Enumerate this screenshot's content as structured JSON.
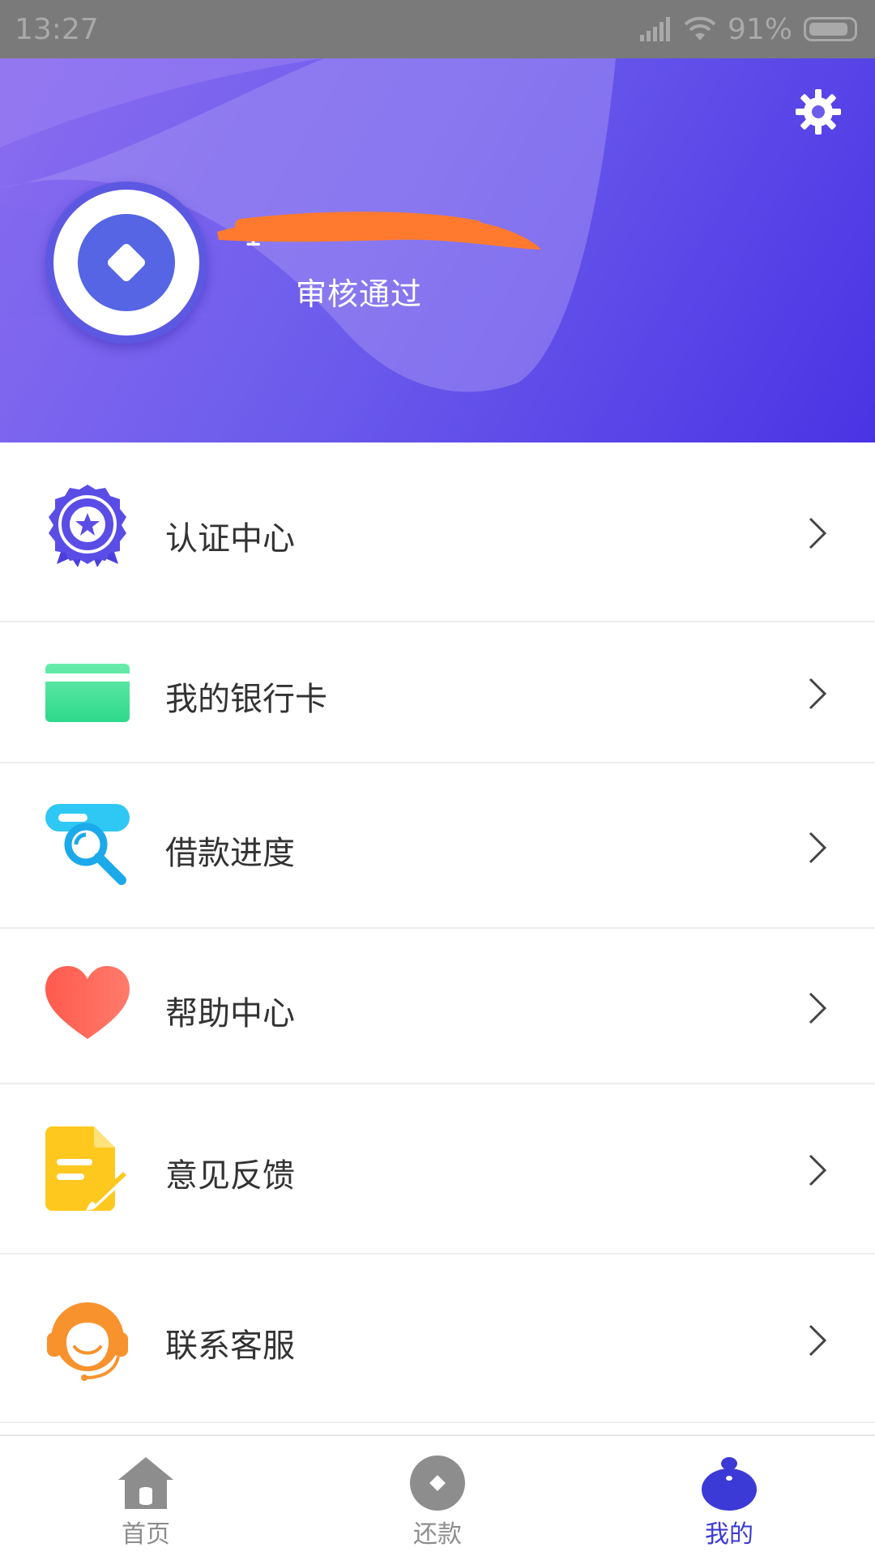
{
  "status_bar": {
    "time": "13:27",
    "battery": "91%",
    "battery_level": 0.91,
    "signal_icon": "signal-icon",
    "wifi_icon": "wifi-icon"
  },
  "header": {
    "user_name": "1",
    "review_status": "审核通过",
    "settings_icon": "gear-icon",
    "accent_color": "#4a33e4"
  },
  "menu": {
    "items": [
      {
        "label": "认证中心",
        "icon": "certificate-badge-icon"
      },
      {
        "label": "我的银行卡",
        "icon": "bank-card-icon"
      },
      {
        "label": "借款进度",
        "icon": "search-progress-icon"
      },
      {
        "label": "帮助中心",
        "icon": "heart-icon"
      },
      {
        "label": "意见反馈",
        "icon": "feedback-note-icon"
      },
      {
        "label": "联系客服",
        "icon": "customer-service-headset-icon"
      }
    ]
  },
  "bottom_nav": {
    "items": [
      {
        "label": "首页",
        "icon": "home-icon",
        "active": false
      },
      {
        "label": "还款",
        "icon": "repay-coin-icon",
        "active": false
      },
      {
        "label": "我的",
        "icon": "profile-icon",
        "active": true
      }
    ],
    "active_color": "#3b3ad6"
  }
}
